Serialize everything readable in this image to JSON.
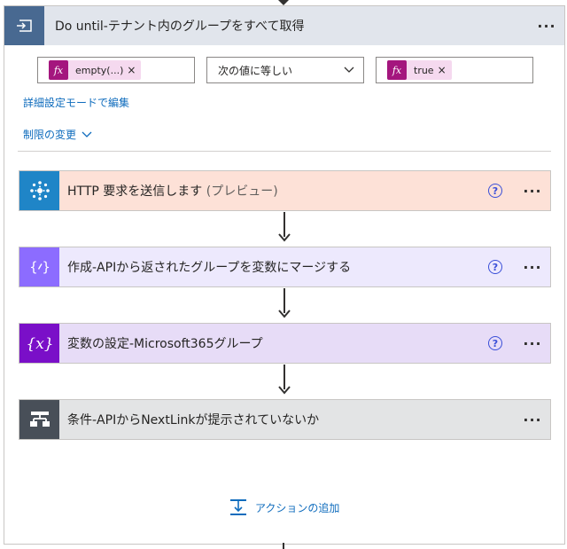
{
  "loop": {
    "title": "Do until-テナント内のグループをすべて取得",
    "condition": {
      "left_token": "empty(...)",
      "operator": "次の値に等しい",
      "right_token": "true",
      "remove_glyph": "×",
      "fx_glyph": "fx"
    },
    "advanced_link": "詳細設定モードで編集",
    "limit_link": "制限の変更",
    "more_glyph": "···"
  },
  "actions": [
    {
      "title": "HTTP 要求を送信します",
      "suffix": " (プレビュー)",
      "icon": "network-hub-icon",
      "bg": "#fde1d7",
      "icon_bg": "#1f85c7",
      "help": true
    },
    {
      "title": "作成-APIから返されたグループを変数にマージする",
      "suffix": "",
      "icon": "compose-icon",
      "bg": "#ede9fd",
      "icon_bg": "#8c6cff",
      "help": true
    },
    {
      "title": "変数の設定-Microsoft365グループ",
      "suffix": "",
      "icon": "variable-icon",
      "bg": "#e7dcf7",
      "icon_bg": "#7a0fc8",
      "help": true
    },
    {
      "title": "条件-APIからNextLinkが提示されていないか",
      "suffix": "",
      "icon": "condition-icon",
      "bg": "#e3e4e5",
      "icon_bg": "#484f58",
      "help": false
    }
  ],
  "add_action_label": "アクションの追加",
  "help_glyph": "?",
  "colors": {
    "loop_header_bg": "#e1e5ec",
    "loop_icon_bg": "#486991",
    "link": "#0f6cbd",
    "fx": "#a4167e"
  }
}
